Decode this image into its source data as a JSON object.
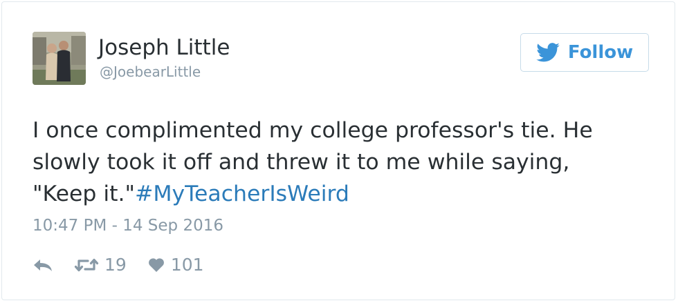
{
  "author": {
    "name": "Joseph Little",
    "handle": "@JoebearLittle"
  },
  "follow_button": {
    "label": "Follow",
    "icon": "twitter-bird-icon",
    "color": "#3b94d9"
  },
  "tweet": {
    "text_lines": [
      "I once complimented my college professor's tie. He",
      "slowly took it off and threw it to me while saying,",
      "\"Keep it.\""
    ],
    "hashtag": "#MyTeacherIsWeird",
    "hashtag_color": "#2b7bb9",
    "timestamp": "10:47 PM - 14 Sep 2016"
  },
  "actions": {
    "reply_icon": "reply-icon",
    "retweet_icon": "retweet-icon",
    "retweet_count": "19",
    "like_icon": "heart-icon",
    "like_count": "101"
  }
}
